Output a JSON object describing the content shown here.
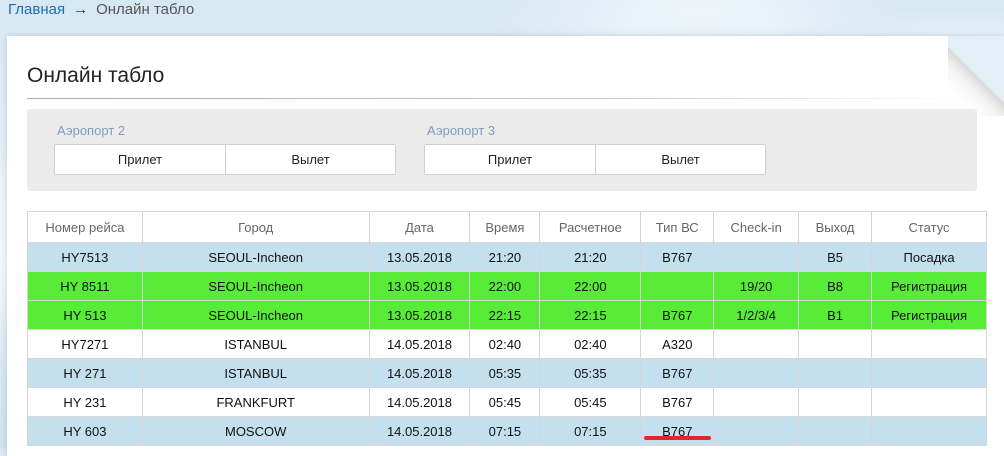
{
  "breadcrumb": {
    "home": "Главная",
    "separator": "→",
    "current": "Онлайн табло"
  },
  "page": {
    "title": "Онлайн табло"
  },
  "airports": [
    {
      "label": "Аэропорт 2",
      "arrival": "Прилет",
      "departure": "Вылет"
    },
    {
      "label": "Аэропорт 3",
      "arrival": "Прилет",
      "departure": "Вылет"
    }
  ],
  "table": {
    "headers": [
      "Номер рейса",
      "Город",
      "Дата",
      "Время",
      "Расчетное",
      "Тип ВС",
      "Check-in",
      "Выход",
      "Статус"
    ],
    "rows": [
      [
        "HY7513",
        "SEOUL-Incheon",
        "13.05.2018",
        "21:20",
        "21:20",
        "B767",
        "",
        "B5",
        "Посадка"
      ],
      [
        "HY 8511",
        "SEOUL-Incheon",
        "13.05.2018",
        "22:00",
        "22:00",
        "",
        "19/20",
        "B8",
        "Регистрация"
      ],
      [
        "HY 513",
        "SEOUL-Incheon",
        "13.05.2018",
        "22:15",
        "22:15",
        "B767",
        "1/2/3/4",
        "B1",
        "Регистрация"
      ],
      [
        "HY7271",
        "ISTANBUL",
        "14.05.2018",
        "02:40",
        "02:40",
        "A320",
        "",
        "",
        ""
      ],
      [
        "HY 271",
        "ISTANBUL",
        "14.05.2018",
        "05:35",
        "05:35",
        "B767",
        "",
        "",
        ""
      ],
      [
        "HY 231",
        "FRANKFURT",
        "14.05.2018",
        "05:45",
        "05:45",
        "B767",
        "",
        "",
        ""
      ],
      [
        "HY 603",
        "MOSCOW",
        "14.05.2018",
        "07:15",
        "07:15",
        "B767",
        "",
        "",
        ""
      ]
    ],
    "row_styles": [
      "blue",
      "green",
      "green",
      "white",
      "blue",
      "white",
      "blue"
    ]
  },
  "colors": {
    "row_blue": "#c4e0ef",
    "row_green": "#58ec38",
    "row_white": "#ffffff",
    "link": "#1d6fb3",
    "annotation_mark": "#e4262c"
  }
}
